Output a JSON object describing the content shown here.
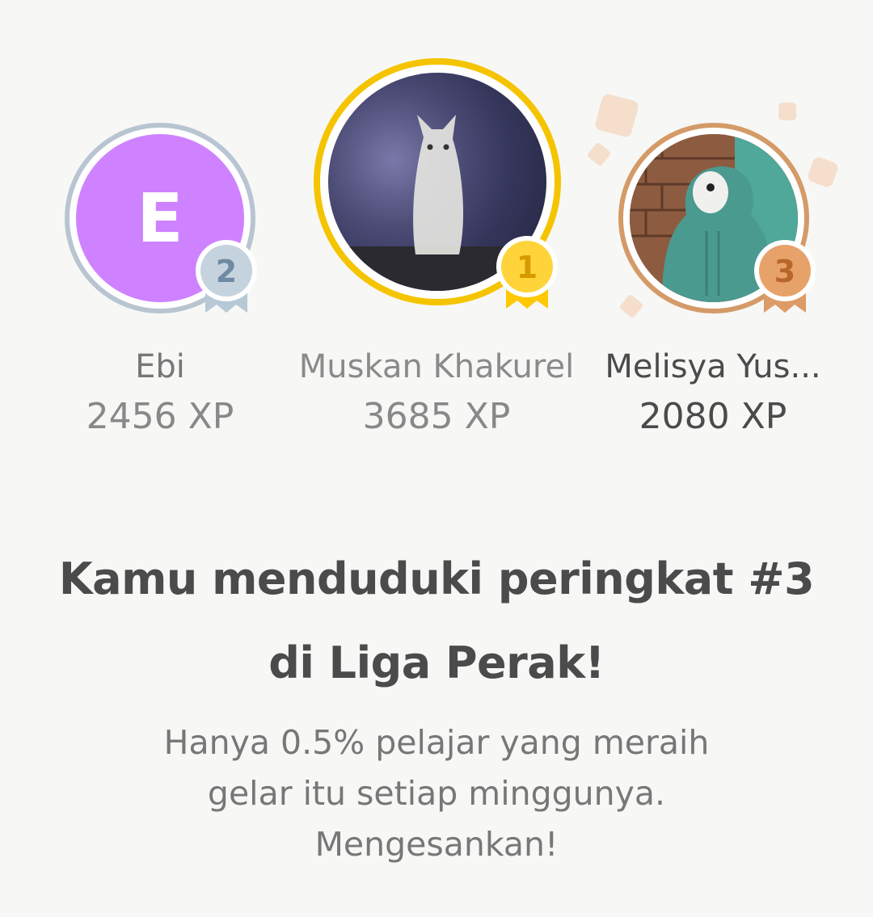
{
  "podium": [
    {
      "rank": "2",
      "name": "Ebi",
      "xp": "2456 XP",
      "avatar_letter": "E",
      "avatar_color": "#ce82ff",
      "ring_color": "#b8c5d1",
      "medal_color": "#a9bccb",
      "medal_text_color": "#6f8aa2"
    },
    {
      "rank": "1",
      "name": "Muskan Khakurel",
      "xp": "3685 XP",
      "ring_color": "#f5c400",
      "medal_color": "#ffc800",
      "medal_text_color": "#d69a00"
    },
    {
      "rank": "3",
      "name": "Melisya Yus...",
      "xp": "2080 XP",
      "ring_color": "#d49a67",
      "medal_color": "#e0a06a",
      "medal_text_color": "#b8672a"
    }
  ],
  "headline": {
    "line1": "Kamu menduduki peringkat #3",
    "line2": "di Liga Perak!"
  },
  "subtext": {
    "line1": "Hanya 0.5% pelajar yang meraih",
    "line2": "gelar itu setiap minggunya.",
    "line3": "Mengesankan!"
  }
}
